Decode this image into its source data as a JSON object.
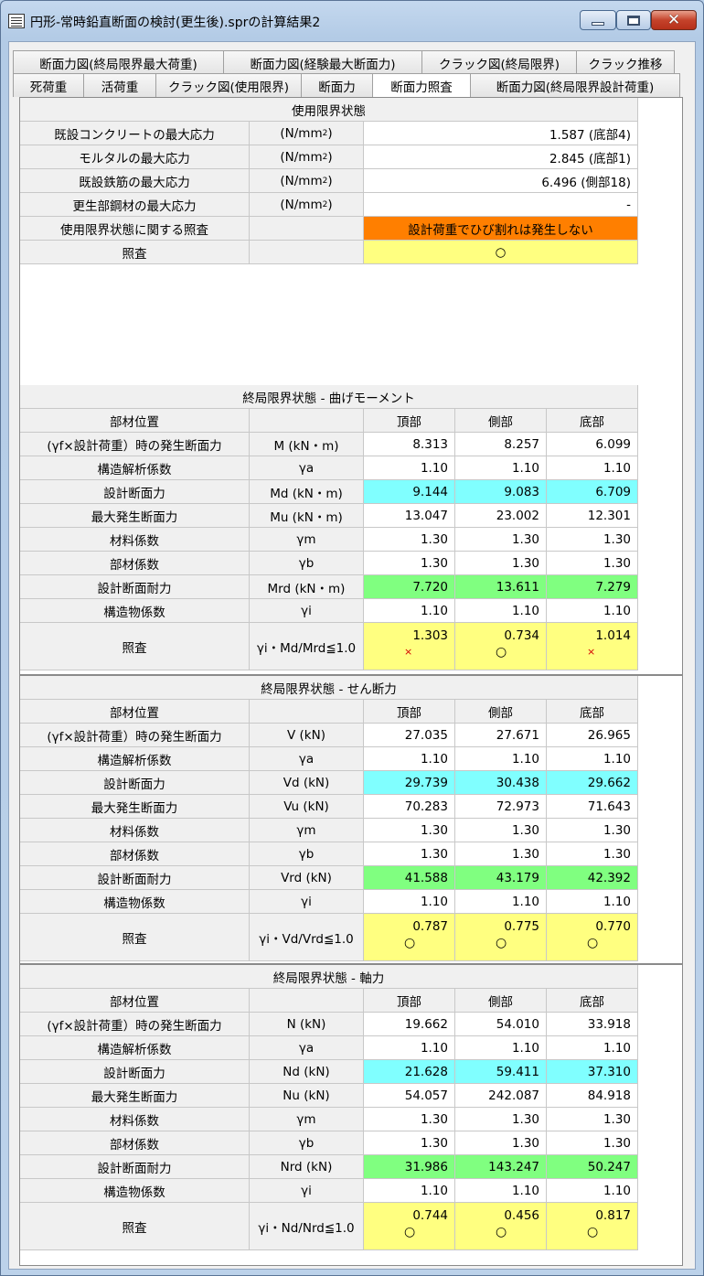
{
  "window": {
    "title": "円形-常時鉛直断面の検討(更生後).sprの計算結果2",
    "controls": {
      "minimize": "—",
      "maximize": "□",
      "close": "✕"
    }
  },
  "tabs": {
    "row1": [
      "断面力図(終局限界最大荷重)",
      "断面力図(経験最大断面力)",
      "クラック図(終局限界)",
      "クラック推移"
    ],
    "row2": [
      "死荷重",
      "活荷重",
      "クラック図(使用限界)",
      "断面力",
      "断面力照査",
      "断面力図(終局限界設計荷重)"
    ],
    "active": "断面力照査"
  },
  "service": {
    "title": "使用限界状態",
    "rows": [
      {
        "label": "既設コンクリートの最大応力",
        "unit": "(N/mm",
        "sup": "2",
        "unit_end": ")",
        "value": "1.587 (底部4)"
      },
      {
        "label": "モルタルの最大応力",
        "unit": "(N/mm",
        "sup": "2",
        "unit_end": ")",
        "value": "2.845 (底部1)"
      },
      {
        "label": "既設鉄筋の最大応力",
        "unit": "(N/mm",
        "sup": "2",
        "unit_end": ")",
        "value": "6.496 (側部18)"
      },
      {
        "label": "更生部鋼材の最大応力",
        "unit": "(N/mm",
        "sup": "2",
        "unit_end": ")",
        "value": "-"
      }
    ],
    "check_label": "使用限界状態に関する照査",
    "check_value": "設計荷重でひび割れは発生しない",
    "judge_label": "照査",
    "judge_value": "○"
  },
  "sections": [
    {
      "title": "終局限界状態 - 曲げモーメント",
      "columns": [
        "頂部",
        "側部",
        "底部"
      ],
      "position_label": "部材位置",
      "rows": [
        {
          "label": "(γf×設計荷重）時の発生断面力",
          "unit": "M (kN・m)",
          "values": [
            "8.313",
            "8.257",
            "6.099"
          ]
        },
        {
          "label": "構造解析係数",
          "unit": "γa",
          "values": [
            "1.10",
            "1.10",
            "1.10"
          ]
        },
        {
          "label": "設計断面力",
          "unit": "Md (kN・m)",
          "values": [
            "9.144",
            "9.083",
            "6.709"
          ],
          "highlight": "cyan"
        },
        {
          "label": "最大発生断面力",
          "unit": "Mu (kN・m)",
          "values": [
            "13.047",
            "23.002",
            "12.301"
          ]
        },
        {
          "label": "材料係数",
          "unit": "γm",
          "values": [
            "1.30",
            "1.30",
            "1.30"
          ]
        },
        {
          "label": "部材係数",
          "unit": "γb",
          "values": [
            "1.30",
            "1.30",
            "1.30"
          ]
        },
        {
          "label": "設計断面耐力",
          "unit": "Mrd (kN・m)",
          "values": [
            "7.720",
            "13.611",
            "7.279"
          ],
          "highlight": "green"
        },
        {
          "label": "構造物係数",
          "unit": "γi",
          "values": [
            "1.10",
            "1.10",
            "1.10"
          ]
        }
      ],
      "judge": {
        "label": "照査",
        "unit": "γi・Md/Mrd≦1.0",
        "values": [
          "1.303",
          "0.734",
          "1.014"
        ],
        "marks": [
          "×",
          "○",
          "×"
        ]
      }
    },
    {
      "title": "終局限界状態 - せん断力",
      "columns": [
        "頂部",
        "側部",
        "底部"
      ],
      "position_label": "部材位置",
      "rows": [
        {
          "label": "(γf×設計荷重）時の発生断面力",
          "unit": "V (kN)",
          "values": [
            "27.035",
            "27.671",
            "26.965"
          ]
        },
        {
          "label": "構造解析係数",
          "unit": "γa",
          "values": [
            "1.10",
            "1.10",
            "1.10"
          ]
        },
        {
          "label": "設計断面力",
          "unit": "Vd (kN)",
          "values": [
            "29.739",
            "30.438",
            "29.662"
          ],
          "highlight": "cyan"
        },
        {
          "label": "最大発生断面力",
          "unit": "Vu (kN)",
          "values": [
            "70.283",
            "72.973",
            "71.643"
          ]
        },
        {
          "label": "材料係数",
          "unit": "γm",
          "values": [
            "1.30",
            "1.30",
            "1.30"
          ]
        },
        {
          "label": "部材係数",
          "unit": "γb",
          "values": [
            "1.30",
            "1.30",
            "1.30"
          ]
        },
        {
          "label": "設計断面耐力",
          "unit": "Vrd (kN)",
          "values": [
            "41.588",
            "43.179",
            "42.392"
          ],
          "highlight": "green"
        },
        {
          "label": "構造物係数",
          "unit": "γi",
          "values": [
            "1.10",
            "1.10",
            "1.10"
          ]
        }
      ],
      "judge": {
        "label": "照査",
        "unit": "γi・Vd/Vrd≦1.0",
        "values": [
          "0.787",
          "0.775",
          "0.770"
        ],
        "marks": [
          "○",
          "○",
          "○"
        ]
      }
    },
    {
      "title": "終局限界状態 - 軸力",
      "columns": [
        "頂部",
        "側部",
        "底部"
      ],
      "position_label": "部材位置",
      "rows": [
        {
          "label": "(γf×設計荷重）時の発生断面力",
          "unit": "N (kN)",
          "values": [
            "19.662",
            "54.010",
            "33.918"
          ]
        },
        {
          "label": "構造解析係数",
          "unit": "γa",
          "values": [
            "1.10",
            "1.10",
            "1.10"
          ]
        },
        {
          "label": "設計断面力",
          "unit": "Nd (kN)",
          "values": [
            "21.628",
            "59.411",
            "37.310"
          ],
          "highlight": "cyan"
        },
        {
          "label": "最大発生断面力",
          "unit": "Nu (kN)",
          "values": [
            "54.057",
            "242.087",
            "84.918"
          ]
        },
        {
          "label": "材料係数",
          "unit": "γm",
          "values": [
            "1.30",
            "1.30",
            "1.30"
          ]
        },
        {
          "label": "部材係数",
          "unit": "γb",
          "values": [
            "1.30",
            "1.30",
            "1.30"
          ]
        },
        {
          "label": "設計断面耐力",
          "unit": "Nrd (kN)",
          "values": [
            "31.986",
            "143.247",
            "50.247"
          ],
          "highlight": "green"
        },
        {
          "label": "構造物係数",
          "unit": "γi",
          "values": [
            "1.10",
            "1.10",
            "1.10"
          ]
        }
      ],
      "judge": {
        "label": "照査",
        "unit": "γi・Nd/Nrd≦1.0",
        "values": [
          "0.744",
          "0.456",
          "0.817"
        ],
        "marks": [
          "○",
          "○",
          "○"
        ]
      }
    }
  ]
}
